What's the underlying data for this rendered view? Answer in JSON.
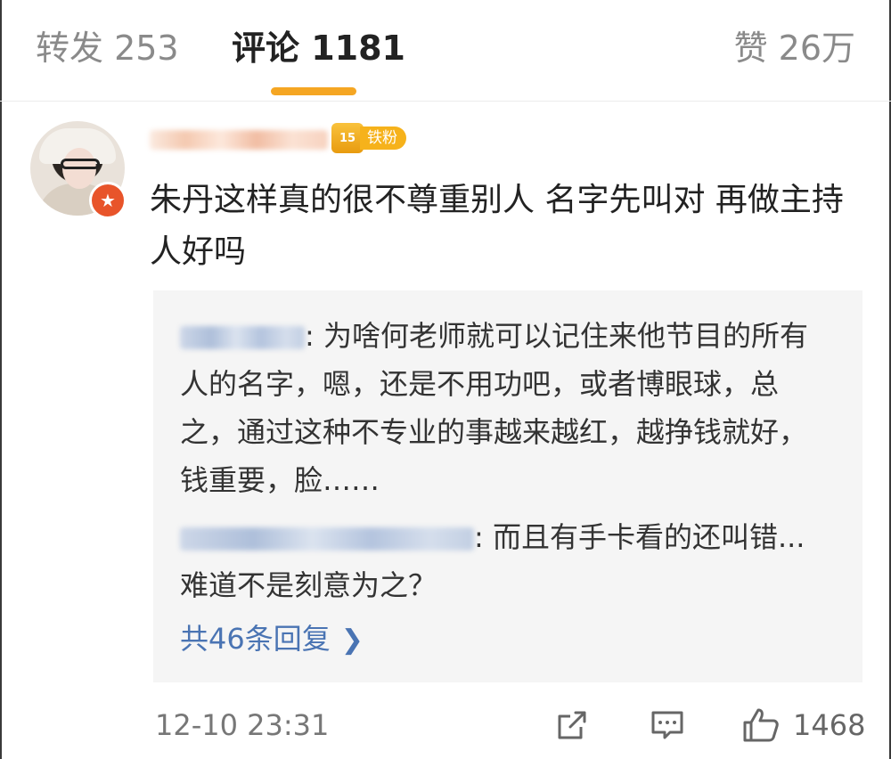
{
  "tabs": {
    "repost": "转发 253",
    "comments": "评论 1181",
    "likes": "赞 26万",
    "active": "comments"
  },
  "comment": {
    "fan_badge": {
      "level": "15",
      "label": "铁粉"
    },
    "text": "朱丹这样真的很不尊重别人 名字先叫对 再做主持人好吗",
    "replies": [
      {
        "text": ": 为啥何老师就可以记住来他节目的所有人的名字，嗯，还是不用功吧，或者博眼球，总之，通过这种不专业的事越来越红，越挣钱就好，钱重要，脸……"
      },
      {
        "text": ": 而且有手卡看的还叫错...难道不是刻意为之？"
      }
    ],
    "more_replies": "共46条回复",
    "timestamp": "12-10 23:31",
    "like_count": "1468"
  },
  "icons": [
    "share-icon",
    "reply-icon",
    "like-icon",
    "chevron-right-icon",
    "verified-star-icon"
  ],
  "colors": {
    "accent": "#f5a623",
    "link": "#4a74b3",
    "reply_bg": "#f5f5f5",
    "badge": "#e8542a"
  }
}
